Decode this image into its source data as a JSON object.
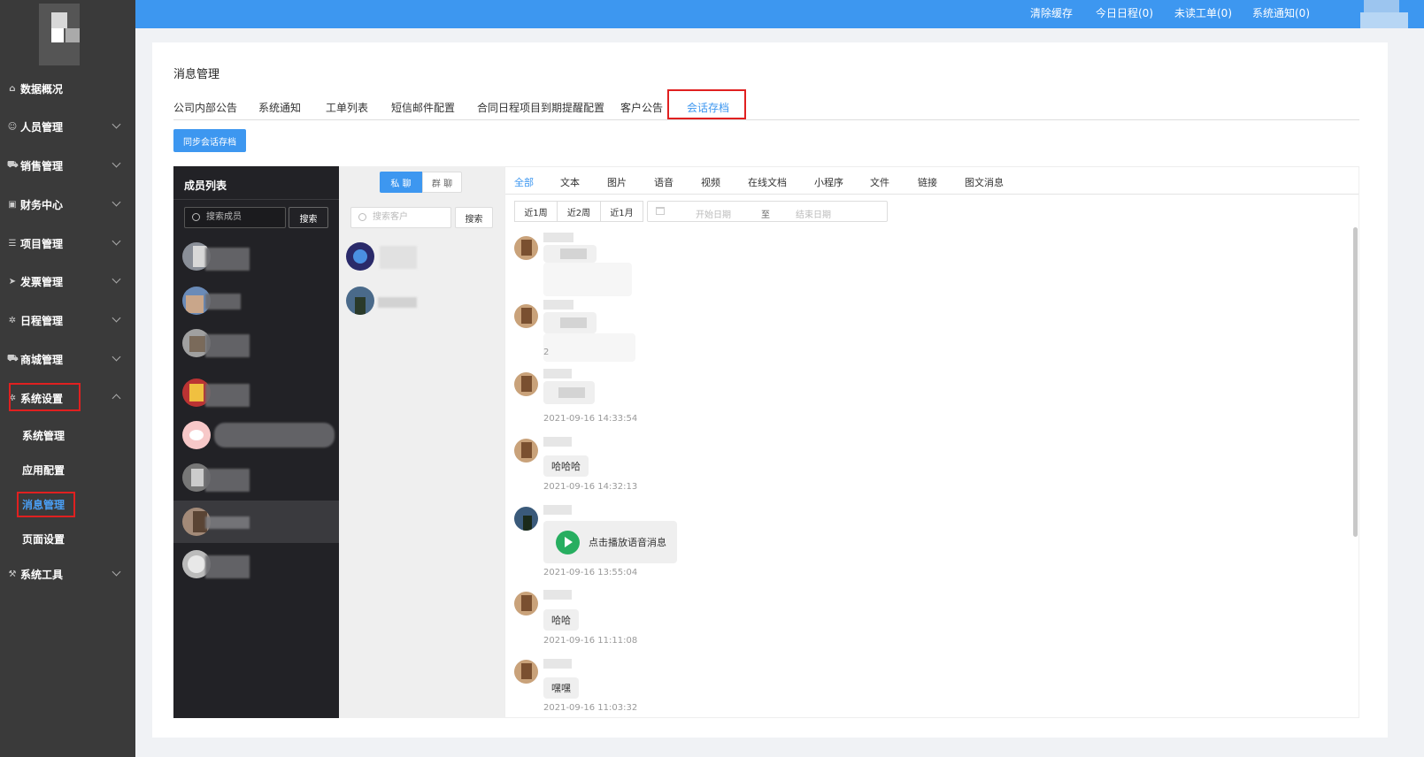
{
  "topbar": {
    "links": [
      "清除缓存",
      "今日日程(0)",
      "未读工单(0)",
      "系统通知(0)"
    ]
  },
  "sidebar": {
    "items": [
      {
        "label": "数据概况",
        "icon": "home-icon"
      },
      {
        "label": "人员管理",
        "icon": "user-icon"
      },
      {
        "label": "销售管理",
        "icon": "cart-icon"
      },
      {
        "label": "财务中心",
        "icon": "money-icon"
      },
      {
        "label": "项目管理",
        "icon": "list-icon"
      },
      {
        "label": "发票管理",
        "icon": "send-icon"
      },
      {
        "label": "日程管理",
        "icon": "gear-icon"
      },
      {
        "label": "商城管理",
        "icon": "cart-icon"
      },
      {
        "label": "系统设置",
        "icon": "gear-icon"
      },
      {
        "label": "系统工具",
        "icon": "wrench-icon"
      }
    ],
    "sub_items": [
      "系统管理",
      "应用配置",
      "消息管理",
      "页面设置"
    ],
    "active_sub": "消息管理"
  },
  "main": {
    "title": "消息管理",
    "tabs": [
      "公司内部公告",
      "系统通知",
      "工单列表",
      "短信邮件配置",
      "合同日程项目到期提醒配置",
      "客户公告",
      "会话存档"
    ],
    "active_tab": "会话存档",
    "sync_button": "同步会话存档"
  },
  "members": {
    "header": "成员列表",
    "search_placeholder": "搜索成员",
    "search_button": "搜索"
  },
  "customers": {
    "seg_private": "私 聊",
    "seg_group": "群 聊",
    "search_placeholder": "搜索客户",
    "search_button": "搜索"
  },
  "messages": {
    "filters": [
      "全部",
      "文本",
      "图片",
      "语音",
      "视频",
      "在线文档",
      "小程序",
      "文件",
      "链接",
      "图文消息"
    ],
    "active_filter": "全部",
    "ranges": [
      "近1周",
      "近2周",
      "近1月"
    ],
    "date_start": "开始日期",
    "date_sep": "至",
    "date_end": "结束日期",
    "items": [
      {
        "text": "",
        "time": ""
      },
      {
        "text": "",
        "time": "2"
      },
      {
        "text": "",
        "time": "2021-09-16 14:33:54"
      },
      {
        "text": "哈哈哈",
        "time": "2021-09-16 14:32:13"
      },
      {
        "text": "点击播放语音消息",
        "time": "2021-09-16 13:55:04"
      },
      {
        "text": "哈哈",
        "time": "2021-09-16 11:11:08"
      },
      {
        "text": "嘿嘿",
        "time": "2021-09-16 11:03:32"
      }
    ]
  },
  "colors": {
    "primary": "#3d97f0",
    "sidebar": "#3a3a3a",
    "member_panel": "#222226",
    "highlight": "#e02020",
    "voice_play": "#27ae60"
  }
}
